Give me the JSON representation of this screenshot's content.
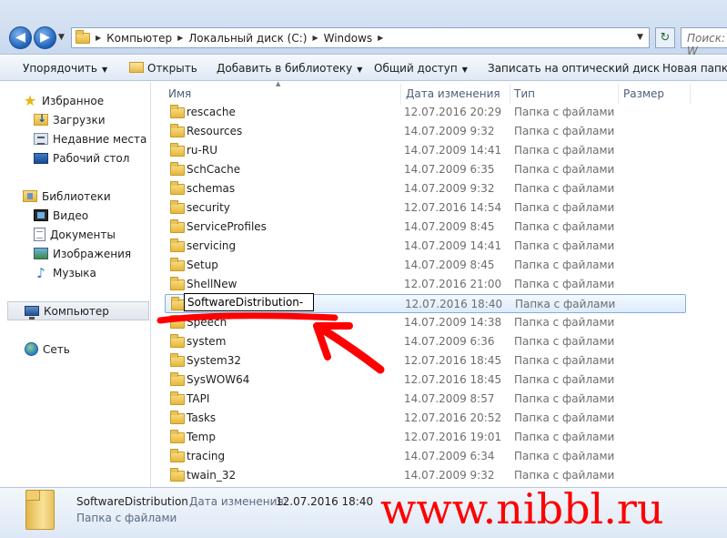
{
  "address_bar": {
    "breadcrumb": [
      "Компьютер",
      "Локальный диск (C:)",
      "Windows"
    ],
    "search_placeholder": "Поиск: W"
  },
  "toolbar": {
    "organize": "Упорядочить",
    "open": "Открыть",
    "add_to_library": "Добавить в библиотеку",
    "share": "Общий доступ",
    "burn": "Записать на оптический диск",
    "new_folder": "Новая папка"
  },
  "navigation": {
    "favorites": "Избранное",
    "downloads": "Загрузки",
    "recent": "Недавние места",
    "desktop": "Рабочий стол",
    "libraries": "Библиотеки",
    "video": "Видео",
    "documents": "Документы",
    "pictures": "Изображения",
    "music": "Музыка",
    "computer": "Компьютер",
    "network": "Сеть"
  },
  "columns": {
    "name": "Имя",
    "date": "Дата изменения",
    "type": "Тип",
    "size": "Размер"
  },
  "files": [
    {
      "name": "rescache",
      "date": "12.07.2016 20:29",
      "type": "Папка с файлами"
    },
    {
      "name": "Resources",
      "date": "14.07.2009 9:32",
      "type": "Папка с файлами"
    },
    {
      "name": "ru-RU",
      "date": "14.07.2009 14:41",
      "type": "Папка с файлами"
    },
    {
      "name": "SchCache",
      "date": "14.07.2009 6:35",
      "type": "Папка с файлами"
    },
    {
      "name": "schemas",
      "date": "14.07.2009 9:32",
      "type": "Папка с файлами"
    },
    {
      "name": "security",
      "date": "12.07.2016 14:54",
      "type": "Папка с файлами"
    },
    {
      "name": "ServiceProfiles",
      "date": "14.07.2009 8:45",
      "type": "Папка с файлами"
    },
    {
      "name": "servicing",
      "date": "14.07.2009 14:41",
      "type": "Папка с файлами"
    },
    {
      "name": "Setup",
      "date": "14.07.2009 8:45",
      "type": "Папка с файлами"
    },
    {
      "name": "ShellNew",
      "date": "12.07.2016 21:00",
      "type": "Папка с файлами"
    },
    {
      "name": "SoftwareDistribution",
      "date": "12.07.2016 18:40",
      "type": "Папка с файлами"
    },
    {
      "name": "Speech",
      "date": "14.07.2009 14:38",
      "type": "Папка с файлами"
    },
    {
      "name": "system",
      "date": "14.07.2009 6:36",
      "type": "Папка с файлами"
    },
    {
      "name": "System32",
      "date": "12.07.2016 18:45",
      "type": "Папка с файлами"
    },
    {
      "name": "SysWOW64",
      "date": "12.07.2016 18:45",
      "type": "Папка с файлами"
    },
    {
      "name": "TAPI",
      "date": "14.07.2009 8:57",
      "type": "Папка с файлами"
    },
    {
      "name": "Tasks",
      "date": "12.07.2016 20:52",
      "type": "Папка с файлами"
    },
    {
      "name": "Temp",
      "date": "12.07.2016 19:01",
      "type": "Папка с файлами"
    },
    {
      "name": "tracing",
      "date": "14.07.2009 6:34",
      "type": "Папка с файлами"
    },
    {
      "name": "twain_32",
      "date": "14.07.2009 9:32",
      "type": "Папка с файлами"
    }
  ],
  "rename": {
    "value": "SoftwareDistribution-"
  },
  "details": {
    "name": "SoftwareDistribution",
    "date_label": "Дата изменения:",
    "date_value": "12.07.2016 18:40",
    "type": "Папка с файлами"
  },
  "watermark": "www.nibbl.ru",
  "annotation_color": "#ff0000"
}
